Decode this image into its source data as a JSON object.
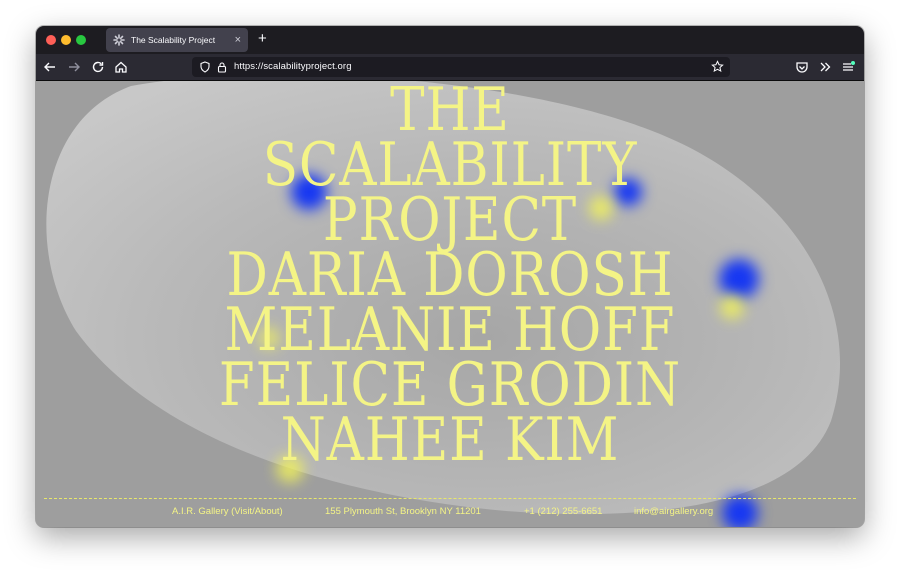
{
  "browser": {
    "tab_title": "The Scalability Project",
    "tab_close": "×",
    "new_tab": "+",
    "url": "https://scalabilityproject.org"
  },
  "page": {
    "headline": [
      "THE",
      "SCALABILITY",
      "PROJECT",
      "DARIA DOROSH",
      "MELANIE HOFF",
      "FELICE GRODIN",
      "NAHEE KIM"
    ],
    "footer": {
      "gallery": "A.I.R. Gallery (Visit/About)",
      "address": "155 Plymouth St, Brooklyn NY 11201",
      "phone": "+1 (212) 255-6651",
      "email": "info@airgallery.org"
    }
  },
  "colors": {
    "accent_yellow": "#f4f486",
    "blob_blue": "#1637f2",
    "background_gray": "#9e9e9e"
  }
}
